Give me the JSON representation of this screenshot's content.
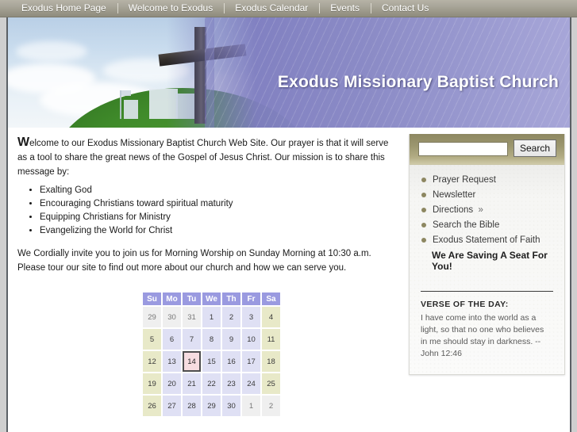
{
  "nav": {
    "items": [
      {
        "label": "Exodus Home Page"
      },
      {
        "label": "Welcome to Exodus"
      },
      {
        "label": "Exodus Calendar"
      },
      {
        "label": "Events"
      },
      {
        "label": "Contact Us"
      }
    ]
  },
  "banner": {
    "title": "Exodus Missionary Baptist Church",
    "image_alt": "cross-on-hill-banner-image"
  },
  "main": {
    "intro_dropcap": "W",
    "intro_rest": "elcome to our Exodus Missionary Baptist Church Web Site. Our prayer is that it will serve as a tool to share the great news of the Gospel of Jesus Christ. Our mission is to share this message by:",
    "mission_items": [
      "Exalting God",
      "Encouraging Christians toward spiritual maturity",
      "Equipping Christians for Ministry",
      "Evangelizing the World for Christ"
    ],
    "invite": "We Cordially invite you to join us for Morning Worship on Sunday Morning at 10:30 a.m.   Please tour our site to find out more about our church and how we can serve you."
  },
  "calendar": {
    "day_headers": [
      "Su",
      "Mo",
      "Tu",
      "We",
      "Th",
      "Fr",
      "Sa"
    ],
    "today": "14",
    "weeks": [
      [
        {
          "d": "29",
          "type": "other"
        },
        {
          "d": "30",
          "type": "other"
        },
        {
          "d": "31",
          "type": "other"
        },
        {
          "d": "1",
          "type": "day"
        },
        {
          "d": "2",
          "type": "day"
        },
        {
          "d": "3",
          "type": "day"
        },
        {
          "d": "4",
          "type": "weekend"
        }
      ],
      [
        {
          "d": "5",
          "type": "weekend"
        },
        {
          "d": "6",
          "type": "day"
        },
        {
          "d": "7",
          "type": "day"
        },
        {
          "d": "8",
          "type": "day"
        },
        {
          "d": "9",
          "type": "day"
        },
        {
          "d": "10",
          "type": "day"
        },
        {
          "d": "11",
          "type": "weekend"
        }
      ],
      [
        {
          "d": "12",
          "type": "weekend"
        },
        {
          "d": "13",
          "type": "day"
        },
        {
          "d": "14",
          "type": "today"
        },
        {
          "d": "15",
          "type": "day"
        },
        {
          "d": "16",
          "type": "day"
        },
        {
          "d": "17",
          "type": "day"
        },
        {
          "d": "18",
          "type": "weekend"
        }
      ],
      [
        {
          "d": "19",
          "type": "weekend"
        },
        {
          "d": "20",
          "type": "day"
        },
        {
          "d": "21",
          "type": "day"
        },
        {
          "d": "22",
          "type": "day"
        },
        {
          "d": "23",
          "type": "day"
        },
        {
          "d": "24",
          "type": "day"
        },
        {
          "d": "25",
          "type": "weekend"
        }
      ],
      [
        {
          "d": "26",
          "type": "weekend"
        },
        {
          "d": "27",
          "type": "day"
        },
        {
          "d": "28",
          "type": "day"
        },
        {
          "d": "29",
          "type": "day"
        },
        {
          "d": "30",
          "type": "day"
        },
        {
          "d": "1",
          "type": "other"
        },
        {
          "d": "2",
          "type": "other"
        }
      ]
    ]
  },
  "sidebar": {
    "search": {
      "value": "",
      "placeholder": "",
      "button_label": "Search"
    },
    "links": [
      {
        "label": "Prayer Request",
        "chevron": ""
      },
      {
        "label": "Newsletter",
        "chevron": ""
      },
      {
        "label": "Directions",
        "chevron": "»"
      },
      {
        "label": "Search the Bible",
        "chevron": ""
      },
      {
        "label": "Exodus Statement of Faith",
        "chevron": ""
      }
    ],
    "seat_line": "We Are Saving A Seat For You!",
    "verse_title": "VERSE OF THE DAY:",
    "verse_text": "I have come into the world as a light, so that no one who believes in me should stay in darkness. -- John 12:46"
  },
  "colors": {
    "nav_bar": "#a9a69a",
    "banner_purple": "#8b8bc6",
    "sidebar_band": "#9c976f",
    "calendar_header": "#9a9ae0",
    "calendar_weekend": "#e8e9c8",
    "calendar_day": "#dfe0f4",
    "calendar_today": "#f7dde0"
  }
}
